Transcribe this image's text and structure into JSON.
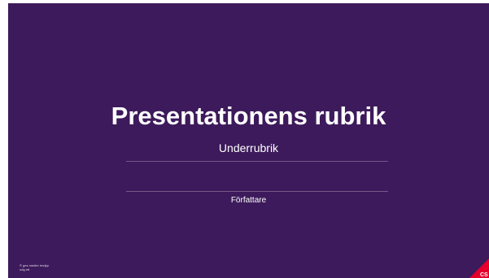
{
  "slide": {
    "title": "Presentationens rubrik",
    "subtitle": "Underrubrik",
    "author": "Författare",
    "footnote_line1": "© ges medier tmrjkp",
    "footnote_line2": "odg ett",
    "logo_text": "CS",
    "background_color": "#3d1a5b",
    "logo_color": "#e4002b"
  }
}
